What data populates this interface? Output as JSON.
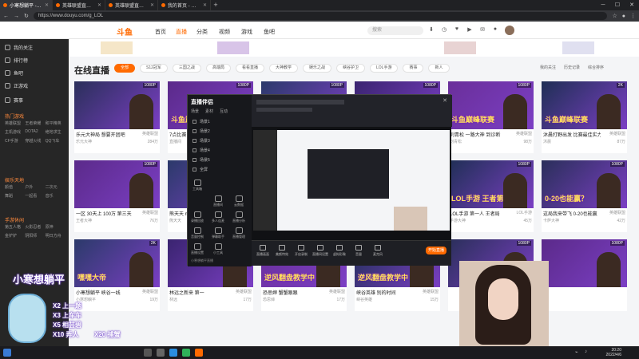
{
  "browser": {
    "tabs": [
      {
        "label": "小寒想躺平 - 直播_英雄联盟直播"
      },
      {
        "label": "英雄联盟直播_lol直播_英雄联盟"
      },
      {
        "label": "英雄联盟直播_lol直播_英雄联盟"
      },
      {
        "label": "我的首页 - 个人中心 - 斗鱼"
      }
    ],
    "new_tab": "+",
    "url": "https://www.douyu.com/g_LOL"
  },
  "site": {
    "logo": "斗鱼",
    "nav": [
      {
        "label": "首页"
      },
      {
        "label": "直播"
      },
      {
        "label": "分类"
      },
      {
        "label": "视频"
      },
      {
        "label": "游戏"
      },
      {
        "label": "鱼吧"
      }
    ],
    "search_placeholder": "搜索",
    "header_icons": [
      "下载",
      "历史",
      "关注",
      "开播",
      "消息"
    ]
  },
  "page": {
    "title": "在线直播",
    "categories": [
      {
        "label": "全部",
        "active": true
      },
      {
        "label": "S12冠军"
      },
      {
        "label": "三国之战"
      },
      {
        "label": "高端局"
      },
      {
        "label": "看看直播"
      },
      {
        "label": "大神教学"
      },
      {
        "label": "娱乐之战"
      },
      {
        "label": "峡谷护卫"
      },
      {
        "label": "LOL手游"
      },
      {
        "label": "赛事"
      },
      {
        "label": "新人"
      }
    ],
    "right_links": [
      "我的关注",
      "历史记录",
      "综合排序"
    ]
  },
  "sidebar": {
    "items": [
      {
        "label": "我的关注"
      },
      {
        "label": "排行榜"
      },
      {
        "label": "鱼吧"
      },
      {
        "label": "正游戏"
      },
      {
        "label": "赛事"
      }
    ],
    "sections": [
      {
        "title": "热门游戏",
        "tags": [
          "英雄联盟",
          "王者荣耀",
          "和平精英",
          "主机游戏",
          "DOTA2",
          "绝地求生",
          "CF手游",
          "穿越火线",
          "QQ飞车"
        ]
      },
      {
        "title": "娱乐天地",
        "tags": [
          "颜值",
          "户外",
          "二次元",
          "舞蹈",
          "一起看",
          "音乐"
        ]
      },
      {
        "title": "手游休闲",
        "tags": [
          "第五人格",
          "火影忍者",
          "原神",
          "金铲铲",
          "阴阳师",
          "明日方舟"
        ]
      }
    ]
  },
  "cards": [
    {
      "res": "1080P",
      "title": "乐元大神局 想要开团吧",
      "cat": "英雄联盟",
      "anchor": "乐元大神",
      "hot": "284万",
      "text": ""
    },
    {
      "res": "1080P",
      "title": "7点比赛 来观看",
      "cat": "英雄联盟",
      "anchor": "直播间",
      "hot": "126万",
      "text": "斗鱼巅峰联赛"
    },
    {
      "res": "1080P",
      "title": "",
      "cat": "",
      "anchor": "",
      "hot": "",
      "text": ""
    },
    {
      "res": "1080P",
      "title": "",
      "cat": "",
      "anchor": "",
      "hot": "",
      "text": ""
    },
    {
      "res": "1080P",
      "title": "刘青松 一路大神 到诊断",
      "cat": "英雄联盟",
      "anchor": "刘青松",
      "hot": "98万",
      "text": "斗鱼巅峰联赛"
    },
    {
      "res": "2K",
      "title": "沐晨打野出发 比赛最佳实力",
      "cat": "英雄联盟",
      "anchor": "沐晨",
      "hot": "87万",
      "text": "斗鱼巅峰联赛"
    },
    {
      "res": "1080P",
      "title": "一区 30天上 100万 第三天",
      "cat": "英雄联盟",
      "anchor": "王者大神",
      "hot": "76万",
      "text": ""
    },
    {
      "res": "1080P",
      "title": "熊天天 mid 王者",
      "cat": "英雄联盟",
      "anchor": "熊天天",
      "hot": "56万",
      "text": ""
    },
    {
      "res": "1080P",
      "title": "",
      "cat": "",
      "anchor": "",
      "hot": "",
      "text": ""
    },
    {
      "res": "1080P",
      "title": "",
      "cat": "",
      "anchor": "",
      "hot": "",
      "text": ""
    },
    {
      "res": "1080P",
      "title": "LOL手游 第一人 王者局",
      "cat": "LOL手游",
      "anchor": "手游大神",
      "hot": "45万",
      "text": "LOL手游 王者第一人"
    },
    {
      "res": "1080P",
      "title": "这局我来带飞 0-20也能赢",
      "cat": "英雄联盟",
      "anchor": "卡萨大神",
      "hot": "42万",
      "text": "0-20也能赢？"
    },
    {
      "res": "2K",
      "title": "小寒想躺平 峡谷一线",
      "cat": "英雄联盟",
      "anchor": "小寒想躺平",
      "hot": "19万",
      "text": "嘿嘿大帝"
    },
    {
      "res": "1080P",
      "title": "林远之新来 第一",
      "cat": "英雄联盟",
      "anchor": "林远",
      "hot": "17万",
      "text": ""
    },
    {
      "res": "1080P",
      "title": "恐思婶 蟹蟹跟跟",
      "cat": "英雄联盟",
      "anchor": "恐思婶",
      "hot": "17万",
      "text": "逆风翻盘教学中"
    },
    {
      "res": "1080P",
      "title": "峡谷英雄 别的时间",
      "cat": "英雄联盟",
      "anchor": "峡谷英雄",
      "hot": "15万",
      "text": "逆风翻盘教学中"
    },
    {
      "res": "1080P",
      "title": "",
      "cat": "",
      "anchor": "",
      "hot": "",
      "text": ""
    },
    {
      "res": "1080P",
      "title": "",
      "cat": "",
      "anchor": "",
      "hot": "",
      "text": ""
    }
  ],
  "obs": {
    "logo": "直播伴侣",
    "tabs": [
      "场景",
      "素材",
      "互动"
    ],
    "scene_rows": [
      "场景1",
      "场景2",
      "场景3",
      "场景4",
      "场景5",
      "全屏"
    ],
    "tools": [
      "工具箱",
      "直播间",
      "云数据",
      "录播回放",
      "多人连麦",
      "直播分析",
      "音量控制",
      "弹幕助手",
      "直播管理",
      "直播设置",
      "小工具"
    ],
    "bottom_buttons": [
      "直播画面",
      "美颜特效",
      "开启录制",
      "直播间设置",
      "虚拟形象",
      "音量",
      "麦克风"
    ],
    "start_label": "开始直播",
    "bottom_left_note": "小寒想躺平直播"
  },
  "overlay": {
    "name": "小寒想躺平",
    "lines": [
      "X2 上一题",
      "X3 上车车",
      "X5 相芸碧",
      "X10 弄人",
      "X20 捕蟹"
    ]
  },
  "taskbar": {
    "time": "20:20",
    "date": "2022/4/6"
  },
  "colors": {
    "accent": "#ff6a00",
    "sidebar_bg": "#262626",
    "obs_bg": "#1c1d22"
  }
}
